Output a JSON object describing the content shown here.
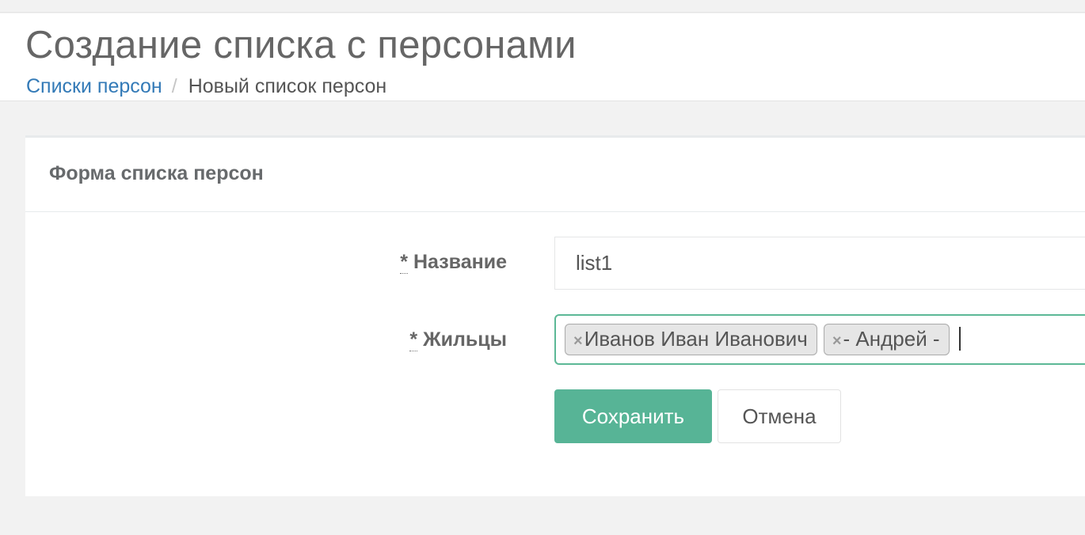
{
  "page": {
    "title": "Создание списка с персонами",
    "breadcrumb": {
      "link": "Списки персон",
      "separator": "/",
      "current": "Новый список персон"
    }
  },
  "form": {
    "title": "Форма списка персон",
    "required_mark": "*",
    "name_label": "Название",
    "name_value": "list1",
    "residents_label": "Жильцы",
    "residents": [
      {
        "remove": "×",
        "label": "Иванов Иван Иванович"
      },
      {
        "remove": "×",
        "label": "- Андрей -"
      }
    ],
    "save_label": "Сохранить",
    "cancel_label": "Отмена"
  },
  "colors": {
    "link": "#337ab7",
    "primary": "#57b496",
    "focus_border": "#5cb896"
  }
}
